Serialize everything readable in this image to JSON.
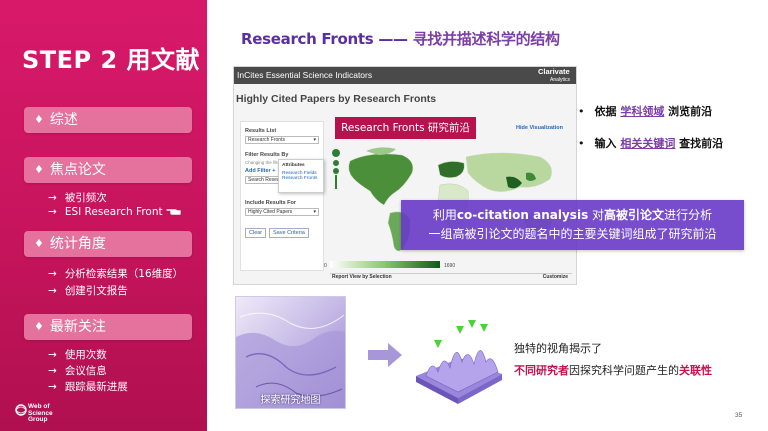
{
  "sidebar": {
    "step_title": "STEP 2  用文献",
    "sections": [
      {
        "label": "综述",
        "items": []
      },
      {
        "label": "焦点论文",
        "items": [
          "被引频次",
          "ESI Research Front"
        ]
      },
      {
        "label": "统计角度",
        "items": [
          "分析检索结果（16维度）",
          "创建引文报告"
        ]
      },
      {
        "label": "最新关注",
        "items": [
          "使用次数",
          "会议信息",
          "跟踪最新进展"
        ]
      }
    ],
    "bullet_glyph": "♦",
    "arrow_glyph": "→",
    "logo": {
      "line1": "Web of",
      "line2": "Science",
      "line3": "Group"
    }
  },
  "main": {
    "title_en": "Research Fronts",
    "title_dash": "——",
    "title_zh": "寻找并描述科学的结构"
  },
  "panel": {
    "header": "InCites Essential Science Indicators",
    "brand": "Clarivate",
    "brand_sub": "Analytics",
    "subtitle": "Highly Cited Papers by Research Fronts",
    "results_list_label": "Results List",
    "results_list_value": "Research Fronts",
    "filter_label": "Filter Results By",
    "filter_note": "Changing the filter ...",
    "add_filter": "Add Filter +",
    "search_placeholder": "Search Resear...",
    "include_label": "Include Results For",
    "include_value": "Highly Cited Papers",
    "clear_btn": "Clear",
    "save_btn": "Save Criteria",
    "attr_title": "Attributes",
    "attr_items": [
      "Research Fields",
      "Research Fronts"
    ],
    "hide_viz": "Hide Visualization",
    "bar_min": "0",
    "bar_max": "1690",
    "report_view": "Report View by Selection",
    "customize": "Customize"
  },
  "callouts": {
    "research_tag": "Research Fronts  研究前沿",
    "box_line1_pre": "利用",
    "box_line1_bold1": "co-citation analysis",
    "box_line1_mid": " 对",
    "box_line1_bold2": "高被引论文",
    "box_line1_post": "进行分析",
    "box_line2": "一组高被引论文的题名中的主要关键词组成了研究前沿"
  },
  "bullets": [
    {
      "pre": "依据 ",
      "link": "学科领域",
      "post": " 浏览前沿"
    },
    {
      "pre": "输入 ",
      "link": "相关关键词",
      "post": " 查找前沿"
    }
  ],
  "bottom": {
    "map_caption": "探索研究地图",
    "unique_text": "独特的视角揭示了",
    "relevance_red1": "不同研究者",
    "relevance_mid": "因探究科学问题产生的",
    "relevance_red2": "关联性"
  },
  "page_number": "35",
  "colors": {
    "brand_magenta": "#c6145c",
    "sidebar_button": "#e4729d",
    "title_purple": "#5b2fa0",
    "callout_purple": "#683ac8",
    "map_green": "#2e7d32"
  }
}
